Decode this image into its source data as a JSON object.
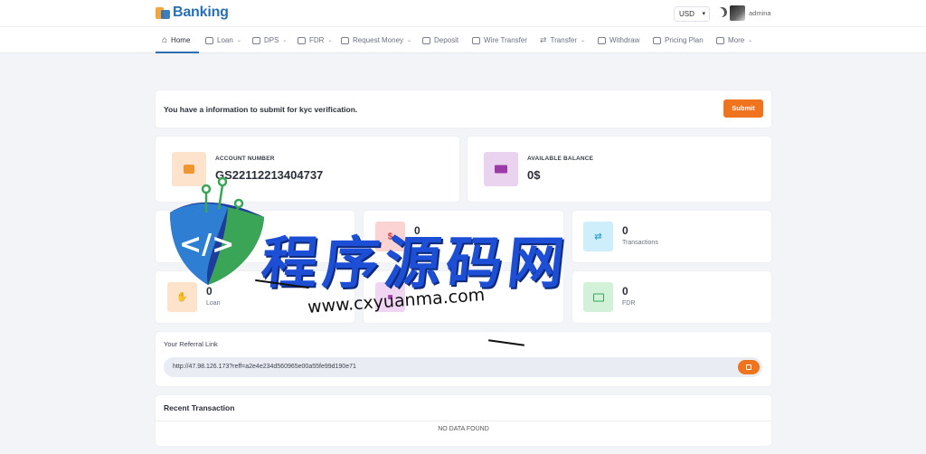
{
  "brand": {
    "name": "Banking"
  },
  "header": {
    "currency": "USD",
    "username": "admina"
  },
  "nav": {
    "items": [
      {
        "label": "Home",
        "dropdown": false,
        "active": true
      },
      {
        "label": "Loan",
        "dropdown": true
      },
      {
        "label": "DPS",
        "dropdown": true
      },
      {
        "label": "FDR",
        "dropdown": true
      },
      {
        "label": "Request Money",
        "dropdown": true
      },
      {
        "label": "Deposit",
        "dropdown": false
      },
      {
        "label": "Wire Transfer",
        "dropdown": false
      },
      {
        "label": "Transfer",
        "dropdown": true
      },
      {
        "label": "Withdraw",
        "dropdown": false
      },
      {
        "label": "Pricing Plan",
        "dropdown": false
      },
      {
        "label": "More",
        "dropdown": true
      }
    ]
  },
  "kyc": {
    "message": "You have a information to submit for kyc verification.",
    "submit_label": "Submit"
  },
  "account": {
    "label": "ACCOUNT NUMBER",
    "value": "GS22112213404737"
  },
  "balance": {
    "label": "AVAILABLE BALANCE",
    "value": "0$"
  },
  "stats": {
    "withdraws": {
      "value": "0",
      "label": "Withdraws"
    },
    "transactions": {
      "value": "0",
      "label": "Transactions"
    },
    "loan": {
      "value": "0",
      "label": "Loan"
    },
    "fdr": {
      "value": "0",
      "label": "FDR"
    }
  },
  "referral": {
    "title": "Your Referral Link",
    "link": "http://47.98.126.173?reff=a2e4e234d560965e00a55fe99d190e71"
  },
  "recent": {
    "title": "Recent Transaction",
    "empty_text": "NO DATA FOUND"
  },
  "watermark": {
    "text": "程序源码网",
    "url": "www.cxyuanma.com"
  },
  "colors": {
    "accent": "#f0741e",
    "brand": "#2a6fb0",
    "watermark": "#1c4fd6"
  }
}
